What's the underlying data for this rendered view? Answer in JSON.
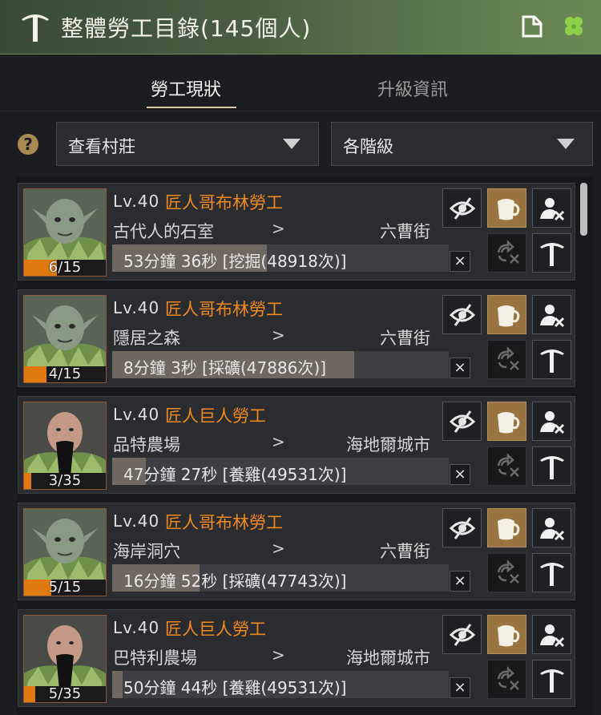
{
  "window": {
    "title": "整體勞工目錄(145個人)"
  },
  "tabs": [
    {
      "label": "勞工現狀",
      "active": true
    },
    {
      "label": "升級資訊",
      "active": false
    }
  ],
  "filters": {
    "village": "查看村莊",
    "grade": "各階級"
  },
  "colors": {
    "accent_orange": "#f08a1e",
    "button_gold": "#9a7440",
    "titlebar_green": "#4a5c42"
  },
  "workers": [
    {
      "level": "Lv.40",
      "name": "匠人哥布林勞工",
      "race": "goblin",
      "location": "古代人的石室",
      "arrow": ">",
      "town": "六曹街",
      "stamina": "6/15",
      "stamina_fraction": 0.4,
      "task": "53分鐘 36秒 [挖掘(48918次)]",
      "task_progress": 0.46,
      "close": "×"
    },
    {
      "level": "Lv.40",
      "name": "匠人哥布林勞工",
      "race": "goblin",
      "location": "隱居之森",
      "arrow": ">",
      "town": "六曹街",
      "stamina": "4/15",
      "stamina_fraction": 0.27,
      "task": "8分鐘 3秒 [採礦(47886次)]",
      "task_progress": 0.72,
      "close": "×"
    },
    {
      "level": "Lv.40",
      "name": "匠人巨人勞工",
      "race": "giant",
      "location": "品特農場",
      "arrow": ">",
      "town": "海地爾城市",
      "stamina": "3/35",
      "stamina_fraction": 0.09,
      "task": "47分鐘 27秒 [養雞(49531次)]",
      "task_progress": 0.1,
      "close": "×"
    },
    {
      "level": "Lv.40",
      "name": "匠人哥布林勞工",
      "race": "goblin",
      "location": "海岸洞穴",
      "arrow": ">",
      "town": "六曹街",
      "stamina": "5/15",
      "stamina_fraction": 0.33,
      "task": "16分鐘 52秒 [採礦(47743次)]",
      "task_progress": 0.26,
      "close": "×"
    },
    {
      "level": "Lv.40",
      "name": "匠人巨人勞工",
      "race": "giant",
      "location": "巴特利農場",
      "arrow": ">",
      "town": "海地爾城市",
      "stamina": "5/35",
      "stamina_fraction": 0.14,
      "task": "50分鐘 44秒 [養雞(49531次)]",
      "task_progress": 0.03,
      "close": "×"
    }
  ]
}
